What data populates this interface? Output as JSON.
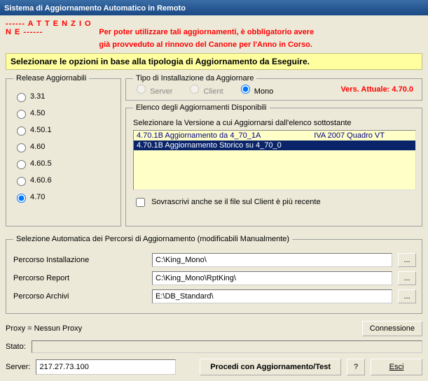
{
  "title": "Sistema di Aggiornamento Automatico in Remoto",
  "attn": {
    "marker": "------ A T T E N Z I O N E ------",
    "line1": "Per poter utilizzare tali aggiornamenti, è obbligatorio avere",
    "line2": "già provveduto al rinnovo del Canone per l'Anno in Corso."
  },
  "yellow_prompt": "Selezionare le opzioni in base alla tipologia di Aggiornamento da Eseguire.",
  "releases": {
    "legend": "Release Aggiornabili",
    "items": [
      "3.31",
      "4.50",
      "4.50.1",
      "4.60",
      "4.60.5",
      "4.60.6",
      "4.70"
    ],
    "selected": "4.70"
  },
  "tipo": {
    "legend": "Tipo di Installazione da Aggiornare",
    "server": "Server",
    "client": "Client",
    "mono": "Mono",
    "vers_label": "Vers. Attuale:  4.70.0"
  },
  "elenco": {
    "legend": "Elenco degli Aggiornamenti Disponibili",
    "sub": "Selezionare la Versione a cui Aggiornarsi dall'elenco sottostante",
    "items": [
      {
        "col1": "4.70.1B  Aggiornamento da 4_70_1A",
        "col2": "IVA 2007 Quadro VT",
        "sel": false
      },
      {
        "col1": "4.70.1B  Aggiornamento Storico su  4_70_0",
        "col2": "",
        "sel": true
      }
    ],
    "overwrite": "Sovrascrivi anche se il file sul Client è più recente"
  },
  "paths": {
    "legend": "Selezione Automatica dei Percorsi di Aggiornamento (modificabili Manualmente)",
    "inst_label": "Percorso Installazione",
    "inst_value": "C:\\King_Mono\\",
    "rpt_label": "Percorso Report",
    "rpt_value": "C:\\King_Mono\\RptKing\\",
    "arc_label": "Percorso Archivi",
    "arc_value": "E:\\DB_Standard\\",
    "browse": "..."
  },
  "proxy": {
    "label": "Proxy = Nessun Proxy",
    "btn": "Connessione"
  },
  "stato_label": "Stato:",
  "server": {
    "label": "Server:",
    "value": "217.27.73.100"
  },
  "actions": {
    "proceed": "Procedi con Aggiornamento/Test",
    "q": "?",
    "esci": "Esci"
  }
}
